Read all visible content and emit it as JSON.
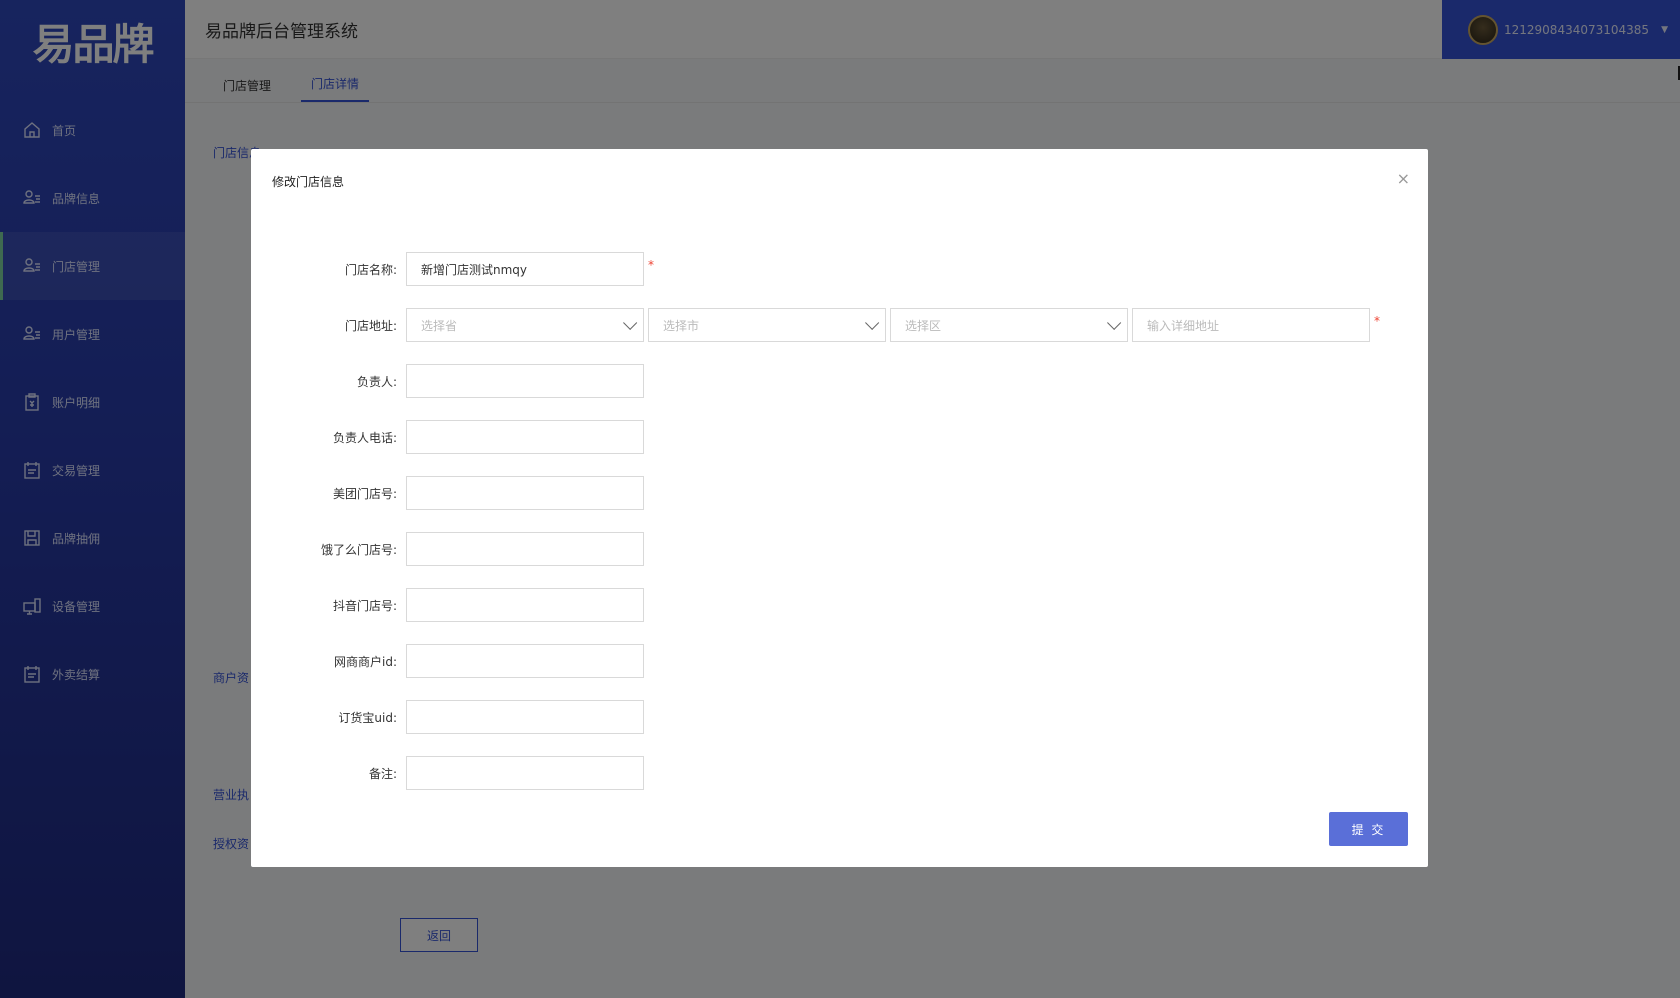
{
  "app": {
    "logo": "易品牌",
    "title": "易品牌后台管理系统"
  },
  "user": {
    "id": "1212908434073104385"
  },
  "sidebar": {
    "items": [
      {
        "label": "首页",
        "icon": "home-icon"
      },
      {
        "label": "品牌信息",
        "icon": "user-list-icon"
      },
      {
        "label": "门店管理",
        "icon": "user-list-icon",
        "active": true
      },
      {
        "label": "用户管理",
        "icon": "user-list-icon"
      },
      {
        "label": "账户明细",
        "icon": "clipboard-yen-icon"
      },
      {
        "label": "交易管理",
        "icon": "calendar-icon"
      },
      {
        "label": "品牌抽佣",
        "icon": "save-icon"
      },
      {
        "label": "设备管理",
        "icon": "device-icon"
      },
      {
        "label": "外卖结算",
        "icon": "calendar-icon"
      }
    ]
  },
  "tabs": [
    {
      "label": "门店管理",
      "active": false
    },
    {
      "label": "门店详情",
      "active": true
    }
  ],
  "background": {
    "store_info": "门店信息",
    "merchant": "商户资",
    "license": "营业执",
    "auth": "授权资",
    "back_button": "返回"
  },
  "modal": {
    "title": "修改门店信息",
    "close": "×",
    "fields": {
      "store_name": {
        "label": "门店名称:",
        "value": "新增门店测试nmqy",
        "required": true
      },
      "address": {
        "label": "门店地址:",
        "province_placeholder": "选择省",
        "city_placeholder": "选择市",
        "district_placeholder": "选择区",
        "detail_placeholder": "输入详细地址",
        "required": true
      },
      "manager": {
        "label": "负责人:"
      },
      "manager_phone": {
        "label": "负责人电话:"
      },
      "meituan": {
        "label": "美团门店号:"
      },
      "eleme": {
        "label": "饿了么门店号:"
      },
      "douyin": {
        "label": "抖音门店号:"
      },
      "wangshang": {
        "label": "网商商户id:"
      },
      "dinghuobao": {
        "label": "订货宝uid:"
      },
      "remark": {
        "label": "备注:"
      }
    },
    "required_mark": "*",
    "submit": "提 交"
  },
  "colors": {
    "accent": "#3553d6",
    "submit": "#5a6fd8",
    "required": "#e43"
  }
}
